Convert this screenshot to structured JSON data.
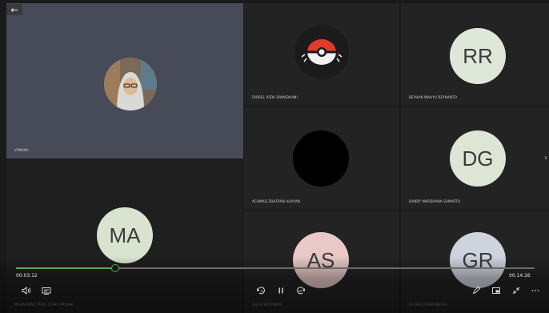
{
  "app": {
    "back_glyph": "←"
  },
  "participants": [
    {
      "name": "VIRNIKA",
      "kind": "photo"
    },
    {
      "name": "FARREL RIZKI RAMADHANI",
      "kind": "pokeball"
    },
    {
      "name": "REYHAN WAHYU REYNANTO",
      "kind": "initials",
      "initials": "RR",
      "color": "#dfe7d8"
    },
    {
      "name": "ACHMAD ZHAFRAN ALVIYAN",
      "kind": "black"
    },
    {
      "name": "DANDY MARDHANA SUMARTO",
      "kind": "initials",
      "initials": "DG",
      "color": "#dde6d5"
    },
    {
      "name": "MUHAMMAD FARIS ZUHDI ARDANI",
      "kind": "initials",
      "initials": "MA",
      "color": "#d9e3cf"
    },
    {
      "name": "AULIA SETIAWAN",
      "kind": "initials",
      "initials": "AS",
      "color": "#e8c9c6"
    },
    {
      "name": "GILANG RAHMANSYAH",
      "kind": "initials",
      "initials": "GR",
      "color": "#cfd3de"
    }
  ],
  "player": {
    "current_time": "00.03.12",
    "total_time": "00.14.26",
    "progress": 0.191,
    "accent": "#4caf50"
  },
  "icons": {
    "volume": "volume-icon",
    "captions": "captions-icon",
    "rewind": "rewind-10-icon",
    "pause": "pause-icon",
    "forward": "forward-30-icon",
    "pen": "pen-icon",
    "cast": "cast-icon",
    "fullscreen_exit": "fullscreen-exit-icon",
    "more": "more-icon",
    "next": "chevron-right-icon"
  }
}
